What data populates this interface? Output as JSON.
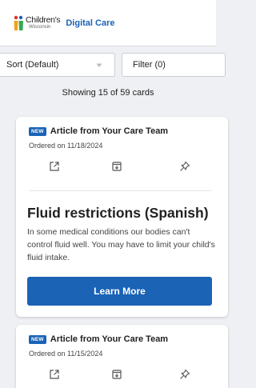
{
  "header": {
    "logo_brand": "Children's",
    "logo_sub": "Wisconsin",
    "title": "Digital Care",
    "logo_icon": "family-logo-icon",
    "brand_color": "#1a63b5"
  },
  "controls": {
    "sort_label": "Sort (Default)",
    "filter_label": "Filter (0)",
    "sort_icon": "chevron-down-icon"
  },
  "showing_text": "Showing 15 of 59 cards",
  "cards": [
    {
      "badge": "NEW",
      "type": "Article from Your Care Team",
      "date": "Ordered on 11/18/2024",
      "icons": [
        "open-external-icon",
        "archive-icon",
        "pin-icon"
      ],
      "title": "Fluid restrictions (Spanish)",
      "description": "In some medical conditions our bodies can't control fluid well. You may have to limit your child's fluid intake.",
      "button": "Learn More"
    },
    {
      "badge": "NEW",
      "type": "Article from Your Care Team",
      "date": "Ordered on 11/15/2024",
      "icons": [
        "open-external-icon",
        "archive-icon",
        "pin-icon"
      ]
    }
  ]
}
